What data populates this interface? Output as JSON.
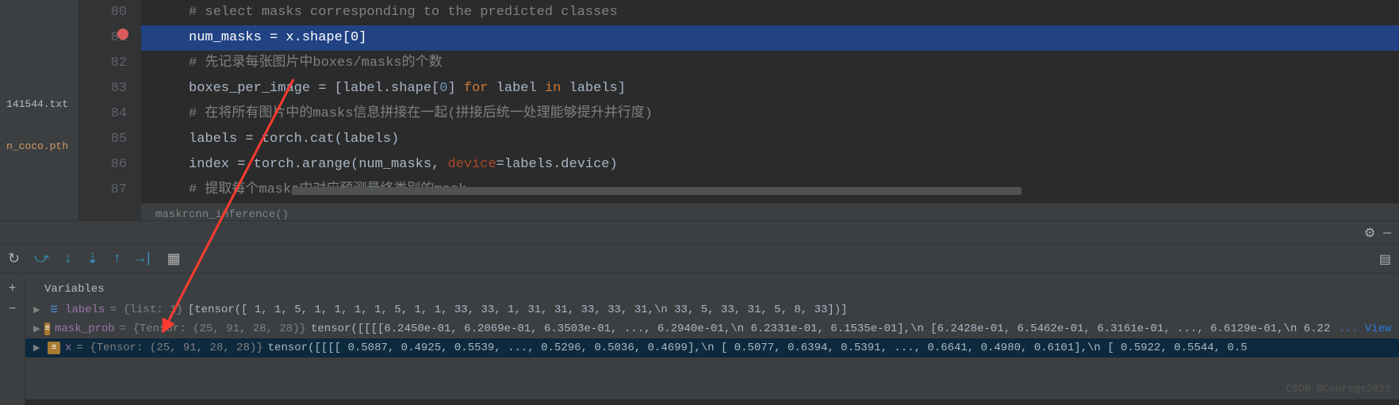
{
  "files": {
    "txt": "141544.txt",
    "pth": "n_coco.pth"
  },
  "lines": {
    "80": "80",
    "81": "81",
    "82": "82",
    "83": "83",
    "84": "84",
    "85": "85",
    "86": "86",
    "87": "87"
  },
  "code": {
    "l80": "# select masks corresponding to the predicted classes",
    "l81_a": "num_masks = x.shape[",
    "l81_b": "0",
    "l81_c": "]",
    "l82": "# 先记录每张图片中boxes/masks的个数",
    "l83_a": "boxes_per_image = [label.shape[",
    "l83_b": "0",
    "l83_c": "] ",
    "l83_d": "for",
    "l83_e": " label ",
    "l83_f": "in",
    "l83_g": " labels]",
    "l84": "# 在将所有图片中的masks信息拼接在一起(拼接后统一处理能够提升并行度)",
    "l85": "labels = torch.cat(labels)",
    "l86_a": "index = torch.arange(num_masks, ",
    "l86_b": "device",
    "l86_c": "=labels.device)",
    "l87": "# 提取每个masks中对应预测最终类别的mask",
    "context": "maskrcnn_inference()"
  },
  "debug": {
    "variables_title": "Variables",
    "labels": {
      "name": "labels",
      "type": " = {list: 1} ",
      "value": "[tensor([ 1,  1,  5,  1,  1,  1,  1,  5,  1,  1, 33, 33,  1, 31, 31, 33, 33, 31,\\n        33,  5, 33, 31,  5,  8, 33])]"
    },
    "mask_prob": {
      "name": "mask_prob",
      "type": " = {Tensor: (25, 91, 28, 28)} ",
      "value": "tensor([[[[6.2450e-01, 6.2069e-01, 6.3503e-01,  ..., 6.2940e-01,\\n           6.2331e-01, 6.1535e-01],\\n          [6.2428e-01, 6.5462e-01, 6.3161e-01,  ..., 6.6129e-01,\\n           6.22",
      "link": "... View"
    },
    "x": {
      "name": "x",
      "type": " = {Tensor: (25, 91, 28, 28)} ",
      "value": "tensor([[[[ 0.5087,  0.4925,  0.5539,  ...,  0.5296,  0.5036,  0.4699],\\n          [ 0.5077,  0.6394,  0.5391,  ...,  0.6641,  0.4980,  0.6101],\\n          [ 0.5922,  0.5544,  0.5"
    }
  },
  "watermark": "CSDN @Courage2022"
}
